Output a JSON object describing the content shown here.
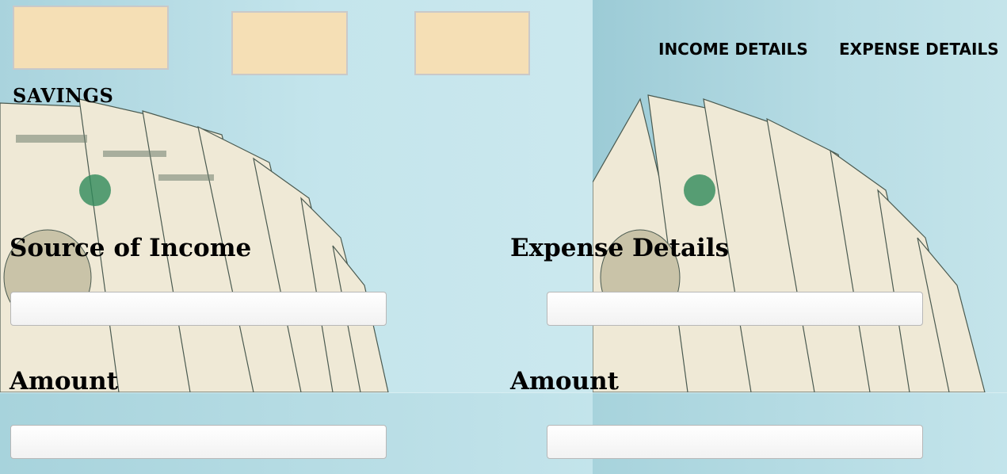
{
  "header": {
    "savings_label": "SAVINGS",
    "nav": {
      "income_label": "INCOME DETAILS",
      "expense_label": "EXPENSE DETAILS"
    }
  },
  "income_form": {
    "source_heading": "Source of Income",
    "source_value": "",
    "amount_heading": "Amount",
    "amount_value": ""
  },
  "expense_form": {
    "details_heading": "Expense Details",
    "details_value": "",
    "amount_heading": "Amount",
    "amount_value": ""
  },
  "colors": {
    "summary_box": "#f5dfb5",
    "background": "#bfe1e8"
  }
}
